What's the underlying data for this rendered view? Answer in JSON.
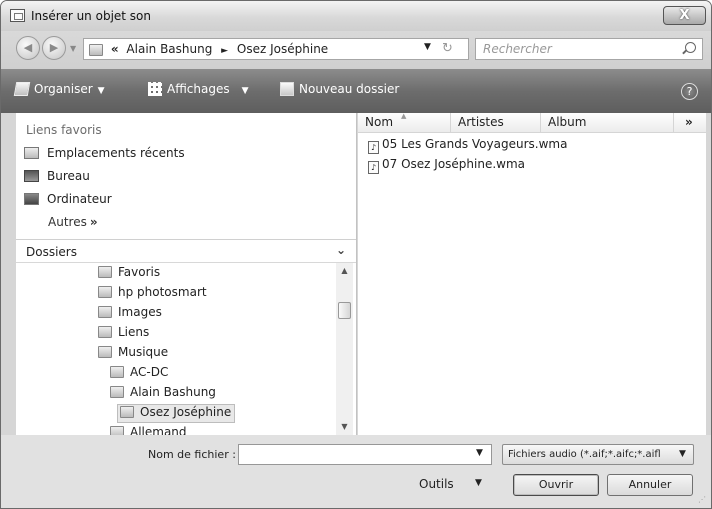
{
  "window": {
    "title": "Insérer un objet son",
    "close_label": "X"
  },
  "address": {
    "chevrons": "«",
    "crumbs": [
      "Alain Bashung",
      "Osez Joséphine"
    ],
    "separator": "►",
    "search_placeholder": "Rechercher"
  },
  "toolbar": {
    "organiser": "Organiser",
    "affichages": "Affichages",
    "nouveau_dossier": "Nouveau dossier",
    "help": "?"
  },
  "left": {
    "favorites_header": "Liens favoris",
    "favorites": [
      "Emplacements récents",
      "Bureau",
      "Ordinateur"
    ],
    "autres": "Autres",
    "autres_chevron": "»",
    "folders_header": "Dossiers",
    "tree": [
      {
        "label": "Favoris",
        "icon": "favorites-folder-icon"
      },
      {
        "label": "hp photosmart",
        "icon": "folder-icon"
      },
      {
        "label": "Images",
        "icon": "pictures-folder-icon"
      },
      {
        "label": "Liens",
        "icon": "links-folder-icon"
      },
      {
        "label": "Musique",
        "icon": "music-folder-icon"
      },
      {
        "label": "AC-DC",
        "icon": "folder-icon"
      },
      {
        "label": "Alain Bashung",
        "icon": "folder-icon"
      },
      {
        "label": "Osez Joséphine",
        "icon": "folder-icon",
        "selected": true
      },
      {
        "label": "Allemand",
        "icon": "folder-icon"
      }
    ]
  },
  "files": {
    "columns": [
      "Nom",
      "Artistes",
      "Album"
    ],
    "more": "»",
    "items": [
      "05 Les Grands Voyageurs.wma",
      "07 Osez Joséphine.wma"
    ]
  },
  "bottom": {
    "filename_label": "Nom de fichier :",
    "filename_value": "",
    "filetype": "Fichiers audio (*.aif;*.aifc;*.aifl",
    "outils": "Outils",
    "ouvrir": "Ouvrir",
    "annuler": "Annuler"
  },
  "colors": {
    "toolbar": "#6d6d6d",
    "selection": "#e8e8e8"
  }
}
